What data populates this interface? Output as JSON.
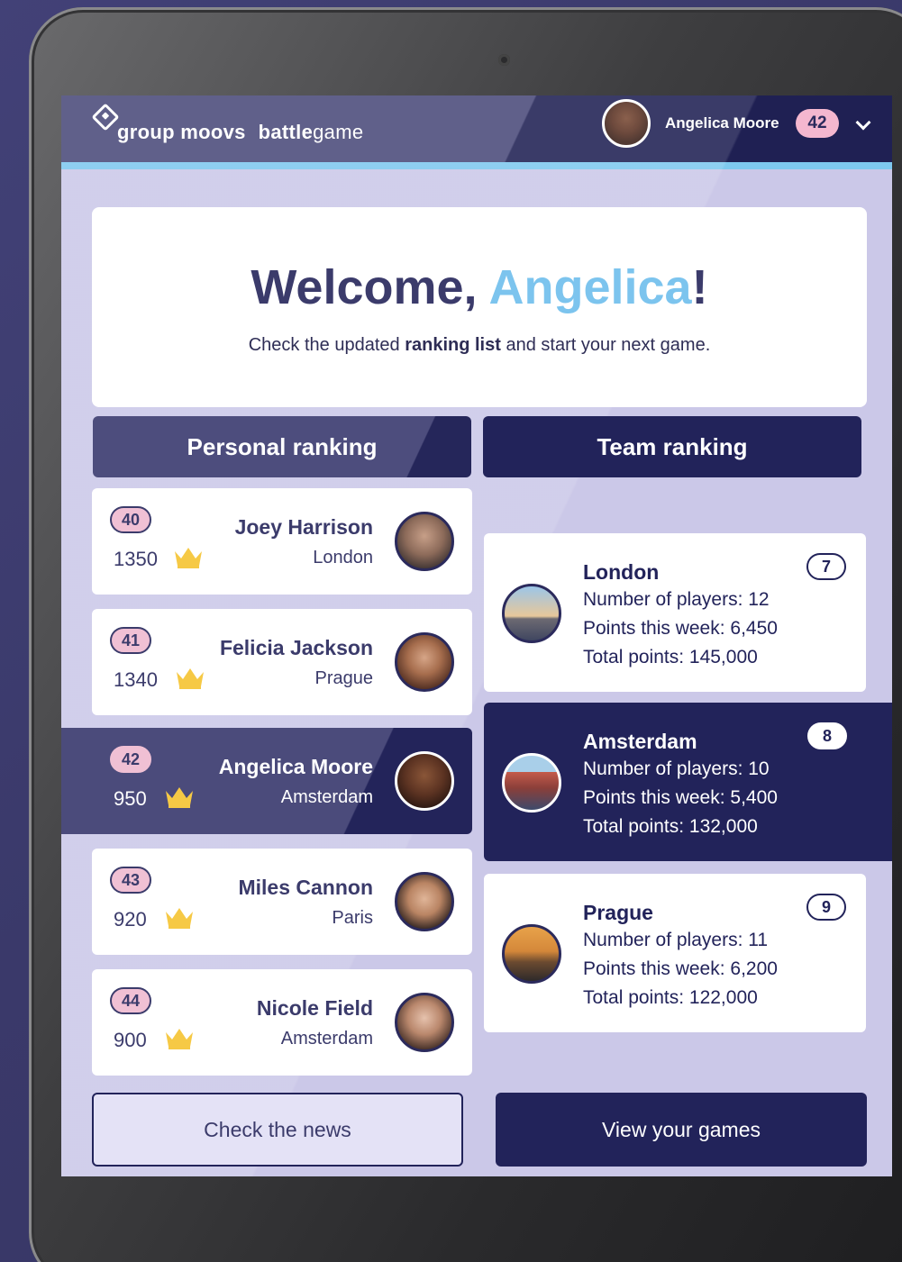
{
  "header": {
    "logo_left": "group moovs",
    "logo_right_bold": "battle",
    "logo_right_rest": "game",
    "user_name": "Angelica Moore",
    "user_rank": "42"
  },
  "welcome": {
    "greeting": "Welcome, ",
    "first_name": "Angelica",
    "exclaim": "!",
    "sub_before": "Check the updated ",
    "sub_bold": "ranking list",
    "sub_after": " and start your next game."
  },
  "tabs": {
    "personal": "Personal ranking",
    "team": "Team ranking"
  },
  "personal_ranking": [
    {
      "rank": "40",
      "points": "1350",
      "name": "Joey Harrison",
      "city": "London"
    },
    {
      "rank": "41",
      "points": "1340",
      "name": "Felicia Jackson",
      "city": "Prague"
    },
    {
      "rank": "42",
      "points": "950",
      "name": "Angelica Moore",
      "city": "Amsterdam"
    },
    {
      "rank": "43",
      "points": "920",
      "name": "Miles Cannon",
      "city": "Paris"
    },
    {
      "rank": "44",
      "points": "900",
      "name": "Nicole Field",
      "city": "Amsterdam"
    }
  ],
  "team_ranking": [
    {
      "rank": "7",
      "city": "London",
      "players": "Number of players: 12",
      "week": "Points this week: 6,450",
      "total": "Total points: 145,000"
    },
    {
      "rank": "8",
      "city": "Amsterdam",
      "players": "Number of players: 10",
      "week": "Points this week: 5,400",
      "total": "Total points: 132,000"
    },
    {
      "rank": "9",
      "city": "Prague",
      "players": "Number of players: 11",
      "week": "Points this week: 6,200",
      "total": "Total points: 122,000"
    }
  ],
  "buttons": {
    "news": "Check the news",
    "games": "View your games"
  },
  "colors": {
    "navy": "#22235a",
    "accent_blue": "#7cc4ee",
    "pink_badge": "#f0c0d4",
    "crown_gold": "#f6c945",
    "screen_bg": "#cbc8e8"
  },
  "icons": {
    "logo": "diamond-logo-icon",
    "dropdown": "chevron-down-icon",
    "score": "crown-icon"
  }
}
